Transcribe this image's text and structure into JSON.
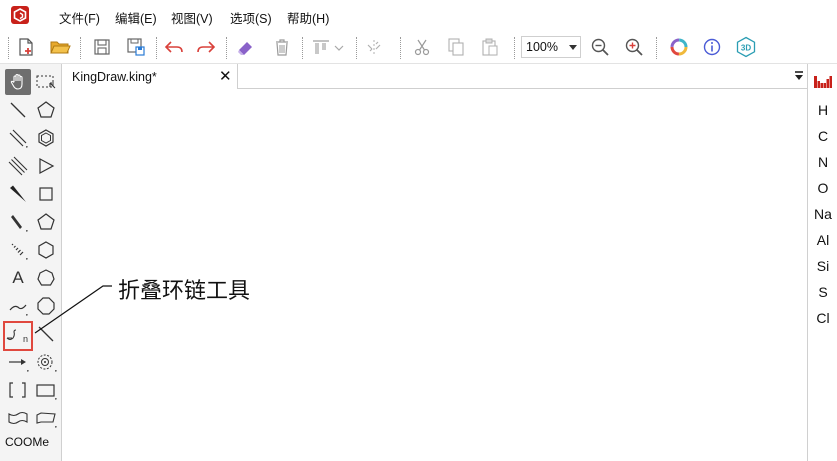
{
  "menu": {
    "items": [
      "文件(F)",
      "编辑(E)",
      "视图(V)",
      "选项(S)",
      "帮助(H)"
    ]
  },
  "toolbar": {
    "zoom": "100%",
    "icons": [
      "new-document-icon",
      "open-folder-icon",
      "save-icon",
      "save-as-icon",
      "undo-icon",
      "redo-icon",
      "eraser-icon",
      "delete-icon",
      "align-icon",
      "flip-icon",
      "cut-icon",
      "copy-icon",
      "paste-icon",
      "zoom-out-icon",
      "zoom-in-icon",
      "color-wheel-icon",
      "info-icon",
      "3d-view-icon"
    ]
  },
  "palette": {
    "bottom_label": "COOMe",
    "text_tool": "A",
    "chain_tool_subscript": "n"
  },
  "document": {
    "tab_title": "KingDraw.king*",
    "close_glyph": "✕"
  },
  "elements": [
    "H",
    "C",
    "N",
    "O",
    "Na",
    "Al",
    "Si",
    "S",
    "Cl"
  ],
  "callout": {
    "text": "折叠环链工具"
  },
  "colors": {
    "accent_red": "#e0483e",
    "active_tool_bg": "#6e6e6e",
    "undo_red": "#d9403a",
    "eraser_purple": "#8a62c9",
    "info_blue": "#4a5bd6",
    "threed_teal": "#2a9db3"
  }
}
